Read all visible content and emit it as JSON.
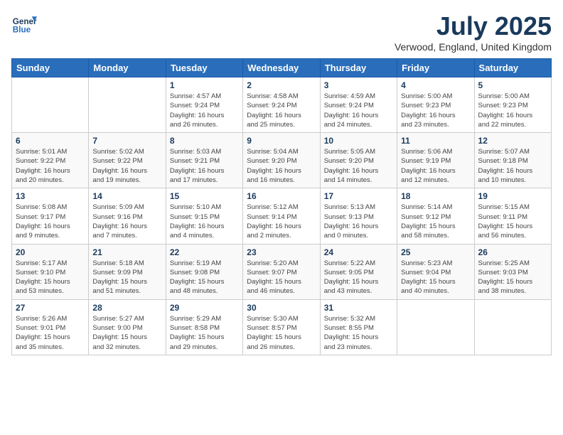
{
  "logo": {
    "line1": "General",
    "line2": "Blue"
  },
  "title": "July 2025",
  "location": "Verwood, England, United Kingdom",
  "days_of_week": [
    "Sunday",
    "Monday",
    "Tuesday",
    "Wednesday",
    "Thursday",
    "Friday",
    "Saturday"
  ],
  "weeks": [
    [
      {
        "num": "",
        "info": ""
      },
      {
        "num": "",
        "info": ""
      },
      {
        "num": "1",
        "info": "Sunrise: 4:57 AM\nSunset: 9:24 PM\nDaylight: 16 hours\nand 26 minutes."
      },
      {
        "num": "2",
        "info": "Sunrise: 4:58 AM\nSunset: 9:24 PM\nDaylight: 16 hours\nand 25 minutes."
      },
      {
        "num": "3",
        "info": "Sunrise: 4:59 AM\nSunset: 9:24 PM\nDaylight: 16 hours\nand 24 minutes."
      },
      {
        "num": "4",
        "info": "Sunrise: 5:00 AM\nSunset: 9:23 PM\nDaylight: 16 hours\nand 23 minutes."
      },
      {
        "num": "5",
        "info": "Sunrise: 5:00 AM\nSunset: 9:23 PM\nDaylight: 16 hours\nand 22 minutes."
      }
    ],
    [
      {
        "num": "6",
        "info": "Sunrise: 5:01 AM\nSunset: 9:22 PM\nDaylight: 16 hours\nand 20 minutes."
      },
      {
        "num": "7",
        "info": "Sunrise: 5:02 AM\nSunset: 9:22 PM\nDaylight: 16 hours\nand 19 minutes."
      },
      {
        "num": "8",
        "info": "Sunrise: 5:03 AM\nSunset: 9:21 PM\nDaylight: 16 hours\nand 17 minutes."
      },
      {
        "num": "9",
        "info": "Sunrise: 5:04 AM\nSunset: 9:20 PM\nDaylight: 16 hours\nand 16 minutes."
      },
      {
        "num": "10",
        "info": "Sunrise: 5:05 AM\nSunset: 9:20 PM\nDaylight: 16 hours\nand 14 minutes."
      },
      {
        "num": "11",
        "info": "Sunrise: 5:06 AM\nSunset: 9:19 PM\nDaylight: 16 hours\nand 12 minutes."
      },
      {
        "num": "12",
        "info": "Sunrise: 5:07 AM\nSunset: 9:18 PM\nDaylight: 16 hours\nand 10 minutes."
      }
    ],
    [
      {
        "num": "13",
        "info": "Sunrise: 5:08 AM\nSunset: 9:17 PM\nDaylight: 16 hours\nand 9 minutes."
      },
      {
        "num": "14",
        "info": "Sunrise: 5:09 AM\nSunset: 9:16 PM\nDaylight: 16 hours\nand 7 minutes."
      },
      {
        "num": "15",
        "info": "Sunrise: 5:10 AM\nSunset: 9:15 PM\nDaylight: 16 hours\nand 4 minutes."
      },
      {
        "num": "16",
        "info": "Sunrise: 5:12 AM\nSunset: 9:14 PM\nDaylight: 16 hours\nand 2 minutes."
      },
      {
        "num": "17",
        "info": "Sunrise: 5:13 AM\nSunset: 9:13 PM\nDaylight: 16 hours\nand 0 minutes."
      },
      {
        "num": "18",
        "info": "Sunrise: 5:14 AM\nSunset: 9:12 PM\nDaylight: 15 hours\nand 58 minutes."
      },
      {
        "num": "19",
        "info": "Sunrise: 5:15 AM\nSunset: 9:11 PM\nDaylight: 15 hours\nand 56 minutes."
      }
    ],
    [
      {
        "num": "20",
        "info": "Sunrise: 5:17 AM\nSunset: 9:10 PM\nDaylight: 15 hours\nand 53 minutes."
      },
      {
        "num": "21",
        "info": "Sunrise: 5:18 AM\nSunset: 9:09 PM\nDaylight: 15 hours\nand 51 minutes."
      },
      {
        "num": "22",
        "info": "Sunrise: 5:19 AM\nSunset: 9:08 PM\nDaylight: 15 hours\nand 48 minutes."
      },
      {
        "num": "23",
        "info": "Sunrise: 5:20 AM\nSunset: 9:07 PM\nDaylight: 15 hours\nand 46 minutes."
      },
      {
        "num": "24",
        "info": "Sunrise: 5:22 AM\nSunset: 9:05 PM\nDaylight: 15 hours\nand 43 minutes."
      },
      {
        "num": "25",
        "info": "Sunrise: 5:23 AM\nSunset: 9:04 PM\nDaylight: 15 hours\nand 40 minutes."
      },
      {
        "num": "26",
        "info": "Sunrise: 5:25 AM\nSunset: 9:03 PM\nDaylight: 15 hours\nand 38 minutes."
      }
    ],
    [
      {
        "num": "27",
        "info": "Sunrise: 5:26 AM\nSunset: 9:01 PM\nDaylight: 15 hours\nand 35 minutes."
      },
      {
        "num": "28",
        "info": "Sunrise: 5:27 AM\nSunset: 9:00 PM\nDaylight: 15 hours\nand 32 minutes."
      },
      {
        "num": "29",
        "info": "Sunrise: 5:29 AM\nSunset: 8:58 PM\nDaylight: 15 hours\nand 29 minutes."
      },
      {
        "num": "30",
        "info": "Sunrise: 5:30 AM\nSunset: 8:57 PM\nDaylight: 15 hours\nand 26 minutes."
      },
      {
        "num": "31",
        "info": "Sunrise: 5:32 AM\nSunset: 8:55 PM\nDaylight: 15 hours\nand 23 minutes."
      },
      {
        "num": "",
        "info": ""
      },
      {
        "num": "",
        "info": ""
      }
    ]
  ]
}
